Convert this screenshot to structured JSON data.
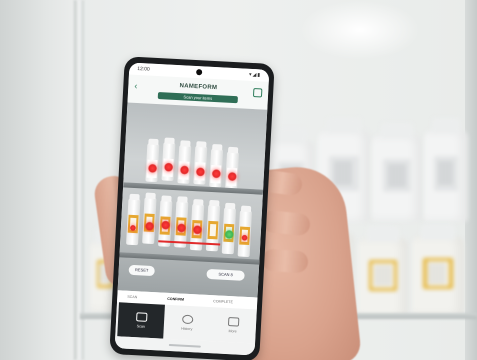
{
  "photo": {
    "description_free": true,
    "subject": "hand-holding-phone"
  },
  "app": {
    "title": "NAMEFORM",
    "subtitle": "Scan your items",
    "back_label": "‹",
    "status": {
      "time": "12:00",
      "icons": "▾◢▮"
    },
    "viewfinder": {
      "left_button": "RESET",
      "right_button": "SCAN 8",
      "marker_count": 13
    },
    "steps": [
      "SCAN",
      "CONFIRM",
      "COMPLETE"
    ],
    "active_step": 1,
    "nav": [
      "Scan",
      "History",
      "More"
    ],
    "active_nav": 0
  },
  "colors": {
    "accent_green": "#2f6e56",
    "marker_red": "#e42a2a",
    "marker_green": "#3eb653",
    "label_amber": "#e6a831"
  }
}
